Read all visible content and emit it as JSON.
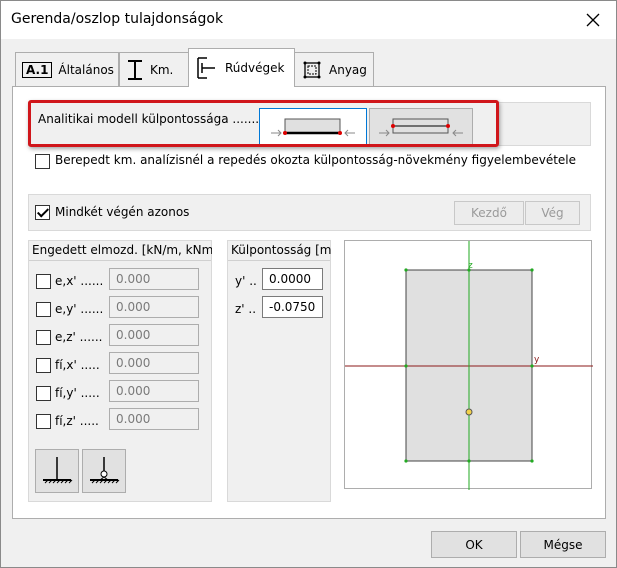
{
  "window": {
    "title": "Gerenda/oszlop tulajdonságok"
  },
  "tabs": [
    {
      "icon_text": "A.1",
      "label": "Általános"
    },
    {
      "label": "Km."
    },
    {
      "label": "Rúdvégek"
    },
    {
      "label": "Anyag"
    }
  ],
  "eccentricity": {
    "label": "Analitikai modell külpontossága ........",
    "crack_checkbox_label": "Berepedt km. analízisnél a repedés okozta külpontosság-növekmény figyelembevétele"
  },
  "ends": {
    "same_label": "Mindkét végén azonos",
    "start_button": "Kezdő",
    "end_button": "Vég"
  },
  "allowed": {
    "header": "Engedett elmozd. [kN/m, kNm/'",
    "rows": [
      {
        "label": "e,x' ......",
        "value": "0.000"
      },
      {
        "label": "e,y' ......",
        "value": "0.000"
      },
      {
        "label": "e,z' ......",
        "value": "0.000"
      },
      {
        "label": "fí,x' .....",
        "value": "0.000"
      },
      {
        "label": "fí,y' .....",
        "value": "0.000"
      },
      {
        "label": "fí,z' .....",
        "value": "0.000"
      }
    ]
  },
  "offset": {
    "header": "Külpontosság [m]",
    "y_label": "y' ..",
    "y_value": "0.0000",
    "z_label": "z' ..",
    "z_value": "-0.0750"
  },
  "section": {
    "y_axis": "y",
    "z_axis": "z"
  },
  "footer": {
    "ok": "OK",
    "cancel": "Mégse"
  },
  "colors": {
    "highlight": "#d0161b",
    "y_axis": "#8b1a1a",
    "z_axis": "#22aa22"
  }
}
